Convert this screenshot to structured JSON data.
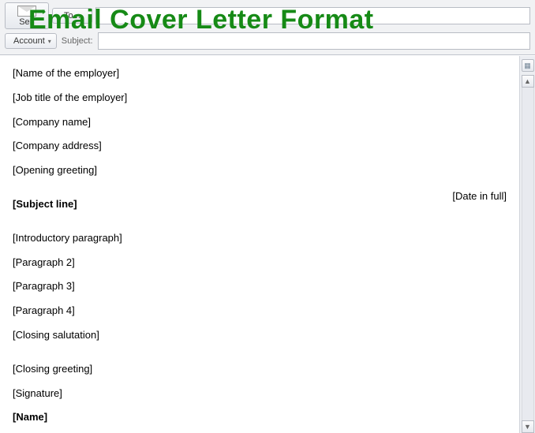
{
  "overlay_title": "Email Cover Letter Format",
  "toolbar": {
    "send_label": "Sen",
    "to_label": "To...",
    "account_label": "Account",
    "subject_label": "Subject:",
    "to_value": "",
    "subject_value": ""
  },
  "body": {
    "employer_name": "[Name of the employer]",
    "employer_title": "[Job title of the employer]",
    "company_name": "[Company name]",
    "company_address": "[Company address]",
    "opening_greeting": "[Opening greeting]",
    "date": "[Date in full]",
    "subject_line": "[Subject line]",
    "intro": "[Introductory paragraph]",
    "para2": "[Paragraph 2]",
    "para3": "[Paragraph 3]",
    "para4": "[Paragraph 4]",
    "closing_salutation": "[Closing salutation]",
    "closing_greeting": "[Closing greeting]",
    "signature": "[Signature]",
    "name": "[Name]"
  }
}
